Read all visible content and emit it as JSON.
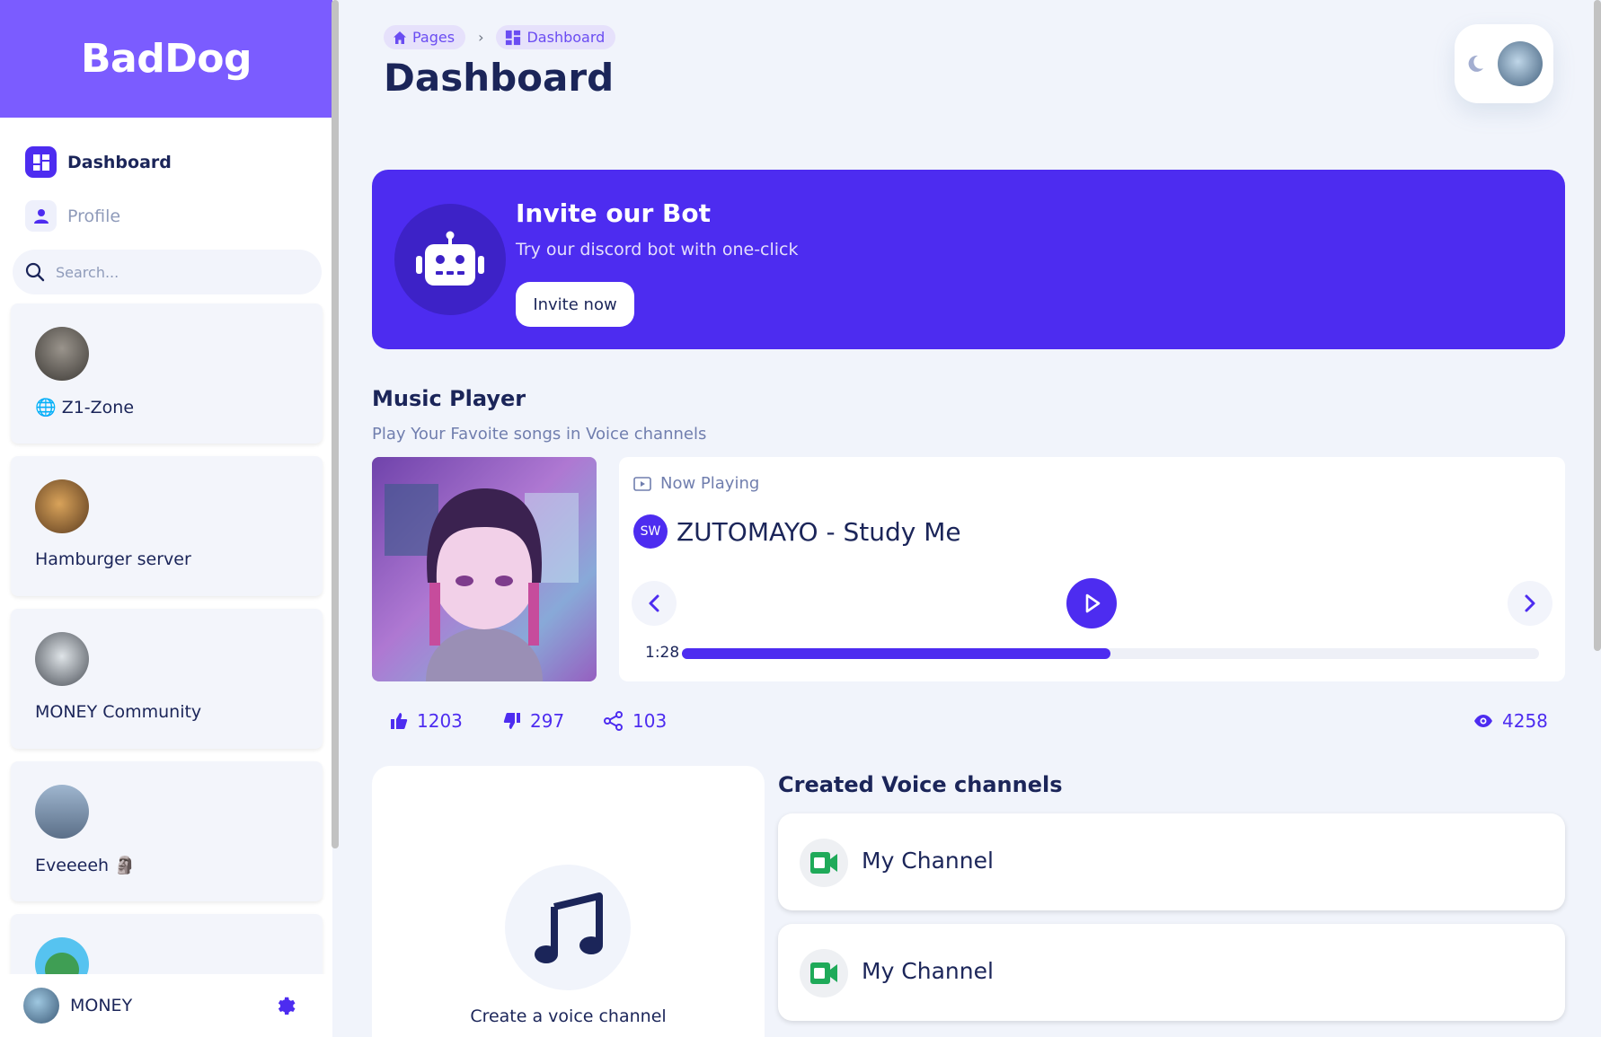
{
  "brand": {
    "name": "BadDog",
    "color": "#7b5cff"
  },
  "nav": [
    {
      "label": "Dashboard",
      "icon": "dashboard-icon",
      "active": true
    },
    {
      "label": "Profile",
      "icon": "person-icon",
      "active": false
    }
  ],
  "search": {
    "placeholder": "Search..."
  },
  "servers": [
    {
      "name": "🌐 Z1-Zone",
      "avatar_color": "#5c5650"
    },
    {
      "name": "Hamburger server",
      "avatar_color": "#b88442"
    },
    {
      "name": "MONEY Community",
      "avatar_color": "#6f8090"
    },
    {
      "name": "Eveeeeh 🗿",
      "avatar_color": "#7e97b4"
    },
    {
      "name": "",
      "avatar_color": "#4cc1f0"
    }
  ],
  "user": {
    "name": "MONEY"
  },
  "breadcrumb": {
    "pages": "Pages",
    "current": "Dashboard",
    "separator": "›"
  },
  "page": {
    "title": "Dashboard"
  },
  "invite": {
    "title": "Invite our Bot",
    "subtitle": "Try our discord bot with one-click",
    "button": "Invite now"
  },
  "music": {
    "title": "Music Player",
    "subtitle": "Play Your Favoite songs in Voice channels",
    "now_playing_label": "Now Playing",
    "badge": "SW",
    "track": "ZUTOMAYO - Study Me",
    "time": "1:28",
    "progress": 0.5,
    "stats": {
      "likes": "1203",
      "dislikes": "297",
      "shares": "103",
      "views": "4258"
    }
  },
  "voice": {
    "create_label": "Create a voice channel",
    "section_title": "Created Voice channels",
    "channels": [
      {
        "name": "My Channel"
      },
      {
        "name": "My Channel"
      }
    ]
  },
  "colors": {
    "accent": "#4d2cf0",
    "text": "#1b2559",
    "muted": "#707eae",
    "bg": "#f1f4fb",
    "channel_green": "#1faa59"
  }
}
